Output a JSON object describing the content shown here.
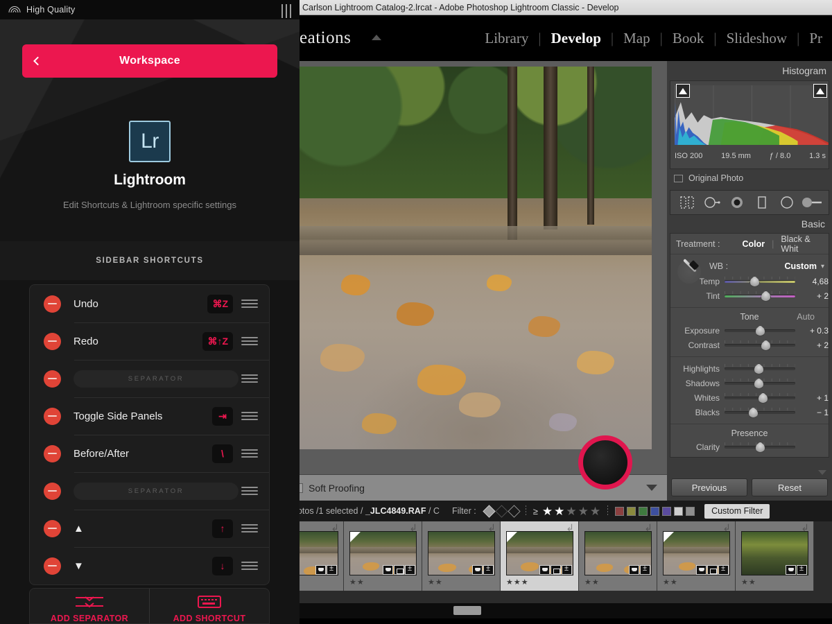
{
  "companion_app": {
    "status_bar": {
      "connection_label": "High Quality",
      "wifi_icon": "wifi-icon",
      "menu_icon": "menu-bars-icon"
    },
    "workspace_button": {
      "label": "Workspace",
      "back_icon": "chevron-left-icon",
      "accent": "#ec174f"
    },
    "hero": {
      "logo_text": "Lr",
      "app_name": "Lightroom",
      "subtitle": "Edit Shortcuts & Lightroom specific settings",
      "logo_bg": "#1b3a4d",
      "logo_border": "#9ecbe0"
    },
    "section_header": "SIDEBAR SHORTCUTS",
    "shortcuts": [
      {
        "type": "shortcut",
        "label": "Undo",
        "keys": "⌘Z",
        "remove_icon": "remove-icon",
        "drag_icon": "drag-handle-icon"
      },
      {
        "type": "shortcut",
        "label": "Redo",
        "keys": "⌘↑Z",
        "remove_icon": "remove-icon",
        "drag_icon": "drag-handle-icon"
      },
      {
        "type": "separator",
        "label": "SEPARATOR",
        "keys": "",
        "remove_icon": "remove-icon",
        "drag_icon": "drag-handle-icon"
      },
      {
        "type": "shortcut",
        "label": "Toggle Side Panels",
        "keys": "⇥",
        "remove_icon": "remove-icon",
        "drag_icon": "drag-handle-icon"
      },
      {
        "type": "shortcut",
        "label": "Before/After",
        "keys": "\\",
        "remove_icon": "remove-icon",
        "drag_icon": "drag-handle-icon"
      },
      {
        "type": "separator",
        "label": "SEPARATOR",
        "keys": "",
        "remove_icon": "remove-icon",
        "drag_icon": "drag-handle-icon"
      },
      {
        "type": "shortcut",
        "label": "▲",
        "keys": "↑",
        "remove_icon": "remove-icon",
        "drag_icon": "drag-handle-icon"
      },
      {
        "type": "shortcut",
        "label": "▼",
        "keys": "↓",
        "remove_icon": "remove-icon",
        "drag_icon": "drag-handle-icon"
      }
    ],
    "footer_actions": [
      {
        "label": "ADD SEPARATOR",
        "icon": "add-separator-icon"
      },
      {
        "label": "ADD SHORTCUT",
        "icon": "keyboard-icon"
      }
    ]
  },
  "lightroom": {
    "title_bar": "Carlson Lightroom Catalog-2.lrcat - Adobe Photoshop Lightroom Classic - Develop",
    "brand_text": "eations",
    "modules": [
      {
        "label": "Library",
        "active": false
      },
      {
        "label": "Develop",
        "active": true
      },
      {
        "label": "Map",
        "active": false
      },
      {
        "label": "Book",
        "active": false
      },
      {
        "label": "Slideshow",
        "active": false
      },
      {
        "label": "Pr",
        "active": false
      }
    ],
    "module_divider": "|",
    "histogram": {
      "title": "Histogram",
      "meta": [
        "ISO 200",
        "19.5 mm",
        "ƒ / 8.0",
        "1.3 s"
      ],
      "original_photo_label": "Original Photo",
      "clip_icon": "clipping-warning-icon"
    },
    "tool_strip": [
      "crop-overlay-icon",
      "spot-removal-icon",
      "red-eye-icon",
      "graduated-filter-icon",
      "radial-filter-icon",
      "adjustment-brush-icon"
    ],
    "basic_panel": {
      "title": "Basic",
      "treatment_label": "Treatment :",
      "treatment_color": "Color",
      "treatment_divider": "|",
      "treatment_bw": "Black & Whit",
      "wb_label": "WB :",
      "wb_value": "Custom",
      "dropdown_icon": "chevron-updown-icon",
      "eyedropper_icon": "eyedropper-icon",
      "wb_sliders": [
        {
          "label": "Temp",
          "value": "4,68",
          "pos": 42
        },
        {
          "label": "Tint",
          "value": "+ 2",
          "pos": 58
        }
      ],
      "tone_title": "Tone",
      "auto_label": "Auto",
      "tone_sliders": [
        {
          "label": "Exposure",
          "value": "+ 0.3",
          "pos": 50
        },
        {
          "label": "Contrast",
          "value": "+ 2",
          "pos": 58
        }
      ],
      "detail_sliders": [
        {
          "label": "Highlights",
          "value": "",
          "pos": 48
        },
        {
          "label": "Shadows",
          "value": "",
          "pos": 48
        },
        {
          "label": "Whites",
          "value": "+ 1",
          "pos": 54
        },
        {
          "label": "Blacks",
          "value": "− 1",
          "pos": 40
        }
      ],
      "presence_title": "Presence",
      "presence_sliders": [
        {
          "label": "Clarity",
          "value": "",
          "pos": 50
        }
      ]
    },
    "soft_proofing": {
      "label": "Soft Proofing",
      "checkbox_icon": "checkbox-icon",
      "caret_icon": "caret-down-icon"
    },
    "previous_button": "Previous",
    "reset_button": "Reset",
    "filter_bar": {
      "info_prefix": "hotos /1 selected /",
      "filename": "_JLC4849.RAF",
      "info_suffix": "/ C",
      "filter_label": "Filter :",
      "flag_icons": [
        "flag-pick-icon",
        "flag-unflagged-icon",
        "flag-reject-icon"
      ],
      "rating_operator": "≥",
      "stars_filled": 2,
      "stars_total": 5,
      "color_swatches": [
        "#8c4040",
        "#8a8a3e",
        "#3f7a3f",
        "#3d4f9e",
        "#5a4b9e",
        "#cfcfcf",
        "#8e8e8e"
      ],
      "custom_filter_label": "Custom Filter"
    },
    "filmstrip": [
      {
        "rating": "",
        "selected": false,
        "corner": false,
        "badges": [
          "flag",
          "adj"
        ],
        "autumn": false
      },
      {
        "rating": "★★",
        "selected": false,
        "corner": true,
        "badges": [
          "flag",
          "crop",
          "adj"
        ],
        "autumn": false
      },
      {
        "rating": "★★",
        "selected": false,
        "corner": false,
        "badges": [
          "flag",
          "adj"
        ],
        "autumn": false
      },
      {
        "rating": "★★★",
        "selected": true,
        "corner": true,
        "badges": [
          "flag",
          "crop",
          "adj"
        ],
        "autumn": false
      },
      {
        "rating": "★★",
        "selected": false,
        "corner": false,
        "badges": [
          "flag",
          "adj"
        ],
        "autumn": false
      },
      {
        "rating": "★★",
        "selected": false,
        "corner": true,
        "badges": [
          "flag",
          "crop",
          "adj"
        ],
        "autumn": false
      },
      {
        "rating": "★★",
        "selected": false,
        "corner": false,
        "badges": [
          "flag",
          "adj"
        ],
        "autumn": true
      }
    ]
  }
}
